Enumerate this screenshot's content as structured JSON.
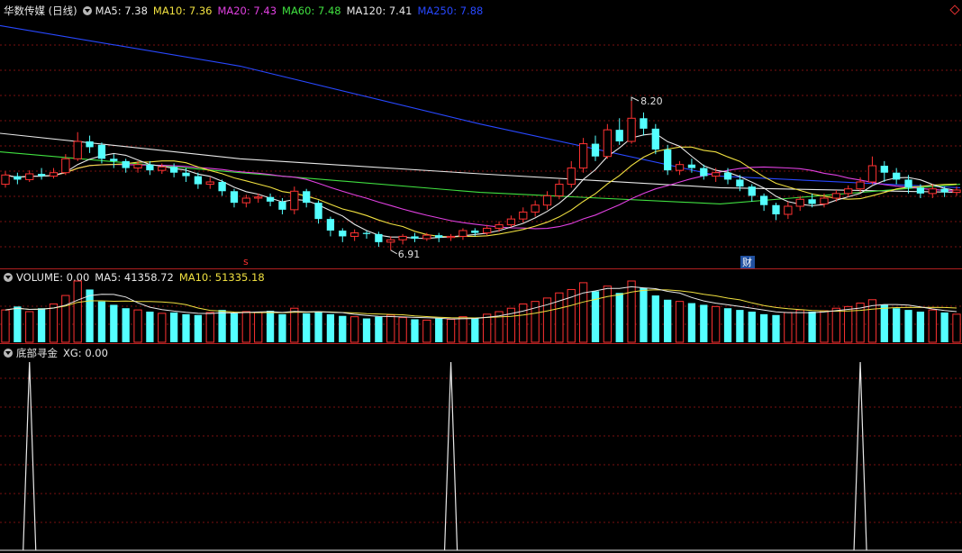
{
  "main": {
    "title": "华数传媒 (日线)",
    "ma": [
      {
        "label": "MA5: 7.38",
        "color": "#e8e8e8"
      },
      {
        "label": "MA10: 7.36",
        "color": "#f0e040"
      },
      {
        "label": "MA20: 7.43",
        "color": "#e040e0"
      },
      {
        "label": "MA60: 7.48",
        "color": "#40e040"
      },
      {
        "label": "MA120: 7.41",
        "color": "#e8e8e8"
      },
      {
        "label": "MA250: 7.88",
        "color": "#2848ff"
      }
    ],
    "high_label": "8.20",
    "low_label": "6.91",
    "marker_s": "s",
    "marker_cai": "财"
  },
  "volume": {
    "labels": [
      {
        "label": "VOLUME: 0.00",
        "color": "#e8e8e8"
      },
      {
        "label": "MA5: 41358.72",
        "color": "#e8e8e8"
      },
      {
        "label": "MA10: 51335.18",
        "color": "#f0e040"
      }
    ]
  },
  "indicator": {
    "title": "底部寻金",
    "xg_label": "XG: 0.00"
  },
  "colors": {
    "up": "#ff3232",
    "down": "#54ffff",
    "grid": "#7a1010"
  },
  "chart_data": {
    "type": "candlestick",
    "ylim": [
      6.8,
      8.9
    ],
    "series": [
      {
        "name": "MA250",
        "color": "#2848ff",
        "values": [
          8.85,
          8.5,
          8.0,
          7.55,
          7.45
        ]
      },
      {
        "name": "MA120",
        "color": "#e8e8e8",
        "values": [
          7.92,
          7.7,
          7.57,
          7.45,
          7.41
        ]
      },
      {
        "name": "MA60",
        "color": "#40e040",
        "values": [
          7.76,
          7.58,
          7.41,
          7.31,
          7.48
        ]
      }
    ],
    "candles": [
      [
        7.48,
        7.56,
        7.59,
        7.45
      ],
      [
        7.55,
        7.52,
        7.58,
        7.48
      ],
      [
        7.52,
        7.57,
        7.6,
        7.5
      ],
      [
        7.57,
        7.55,
        7.62,
        7.52
      ],
      [
        7.55,
        7.58,
        7.62,
        7.53
      ],
      [
        7.58,
        7.7,
        7.74,
        7.56
      ],
      [
        7.7,
        7.85,
        7.93,
        7.68
      ],
      [
        7.85,
        7.8,
        7.9,
        7.75
      ],
      [
        7.82,
        7.7,
        7.84,
        7.66
      ],
      [
        7.7,
        7.68,
        7.74,
        7.62
      ],
      [
        7.68,
        7.62,
        7.7,
        7.58
      ],
      [
        7.62,
        7.65,
        7.68,
        7.58
      ],
      [
        7.65,
        7.6,
        7.68,
        7.56
      ],
      [
        7.6,
        7.63,
        7.66,
        7.57
      ],
      [
        7.63,
        7.58,
        7.66,
        7.54
      ],
      [
        7.58,
        7.55,
        7.62,
        7.5
      ],
      [
        7.55,
        7.48,
        7.58,
        7.44
      ],
      [
        7.48,
        7.5,
        7.54,
        7.44
      ],
      [
        7.5,
        7.42,
        7.52,
        7.38
      ],
      [
        7.42,
        7.32,
        7.44,
        7.28
      ],
      [
        7.32,
        7.36,
        7.39,
        7.28
      ],
      [
        7.36,
        7.37,
        7.4,
        7.32
      ],
      [
        7.37,
        7.33,
        7.4,
        7.29
      ],
      [
        7.33,
        7.26,
        7.36,
        7.22
      ],
      [
        7.26,
        7.42,
        7.46,
        7.22
      ],
      [
        7.42,
        7.32,
        7.44,
        7.28
      ],
      [
        7.32,
        7.18,
        7.34,
        7.14
      ],
      [
        7.18,
        7.08,
        7.2,
        7.03
      ],
      [
        7.08,
        7.03,
        7.1,
        6.98
      ],
      [
        7.03,
        7.06,
        7.09,
        6.99
      ],
      [
        7.06,
        7.05,
        7.08,
        7.01
      ],
      [
        7.05,
        6.98,
        7.07,
        6.94
      ],
      [
        6.98,
        7.0,
        7.03,
        6.91
      ],
      [
        7.0,
        7.03,
        7.05,
        6.96
      ],
      [
        7.03,
        7.01,
        7.06,
        6.98
      ],
      [
        7.01,
        7.04,
        7.06,
        6.99
      ],
      [
        7.04,
        7.02,
        7.06,
        6.98
      ],
      [
        7.02,
        7.03,
        7.05,
        6.99
      ],
      [
        7.03,
        7.08,
        7.1,
        7.0
      ],
      [
        7.08,
        7.06,
        7.1,
        7.03
      ],
      [
        7.06,
        7.1,
        7.13,
        7.04
      ],
      [
        7.1,
        7.13,
        7.16,
        7.07
      ],
      [
        7.13,
        7.18,
        7.21,
        7.11
      ],
      [
        7.18,
        7.24,
        7.28,
        7.15
      ],
      [
        7.24,
        7.3,
        7.34,
        7.2
      ],
      [
        7.3,
        7.38,
        7.42,
        7.26
      ],
      [
        7.38,
        7.48,
        7.52,
        7.35
      ],
      [
        7.48,
        7.62,
        7.68,
        7.45
      ],
      [
        7.62,
        7.83,
        7.88,
        7.58
      ],
      [
        7.83,
        7.72,
        7.9,
        7.68
      ],
      [
        7.72,
        7.95,
        8.0,
        7.7
      ],
      [
        7.95,
        7.85,
        8.05,
        7.82
      ],
      [
        7.85,
        8.05,
        8.2,
        7.83
      ],
      [
        8.05,
        7.96,
        8.1,
        7.9
      ],
      [
        7.96,
        7.78,
        8.0,
        7.74
      ],
      [
        7.78,
        7.6,
        7.82,
        7.56
      ],
      [
        7.6,
        7.65,
        7.68,
        7.56
      ],
      [
        7.65,
        7.62,
        7.7,
        7.58
      ],
      [
        7.62,
        7.55,
        7.65,
        7.52
      ],
      [
        7.55,
        7.58,
        7.62,
        7.5
      ],
      [
        7.58,
        7.52,
        7.62,
        7.48
      ],
      [
        7.52,
        7.46,
        7.56,
        7.42
      ],
      [
        7.46,
        7.38,
        7.48,
        7.33
      ],
      [
        7.38,
        7.3,
        7.4,
        7.25
      ],
      [
        7.3,
        7.22,
        7.32,
        7.17
      ],
      [
        7.22,
        7.29,
        7.33,
        7.18
      ],
      [
        7.29,
        7.35,
        7.38,
        7.25
      ],
      [
        7.35,
        7.31,
        7.4,
        7.28
      ],
      [
        7.31,
        7.36,
        7.4,
        7.28
      ],
      [
        7.36,
        7.4,
        7.43,
        7.33
      ],
      [
        7.4,
        7.44,
        7.47,
        7.37
      ],
      [
        7.44,
        7.5,
        7.54,
        7.41
      ],
      [
        7.5,
        7.64,
        7.72,
        7.48
      ],
      [
        7.64,
        7.58,
        7.68,
        7.5
      ],
      [
        7.58,
        7.52,
        7.62,
        7.48
      ],
      [
        7.52,
        7.45,
        7.56,
        7.4
      ],
      [
        7.45,
        7.4,
        7.48,
        7.36
      ],
      [
        7.4,
        7.44,
        7.48,
        7.36
      ],
      [
        7.44,
        7.41,
        7.46,
        7.37
      ],
      [
        7.41,
        7.43,
        7.46,
        7.38
      ]
    ],
    "volume": [
      38,
      42,
      36,
      40,
      45,
      55,
      72,
      62,
      48,
      44,
      40,
      38,
      36,
      34,
      35,
      33,
      32,
      35,
      38,
      34,
      36,
      35,
      37,
      33,
      40,
      34,
      36,
      33,
      31,
      30,
      28,
      30,
      32,
      29,
      27,
      26,
      28,
      27,
      30,
      29,
      33,
      36,
      40,
      45,
      48,
      52,
      58,
      62,
      70,
      60,
      66,
      58,
      72,
      64,
      55,
      50,
      48,
      46,
      44,
      42,
      40,
      38,
      36,
      33,
      32,
      35,
      38,
      36,
      37,
      40,
      42,
      46,
      50,
      44,
      40,
      38,
      36,
      38,
      35,
      33
    ],
    "xg_signals": [
      2,
      37,
      71
    ]
  }
}
